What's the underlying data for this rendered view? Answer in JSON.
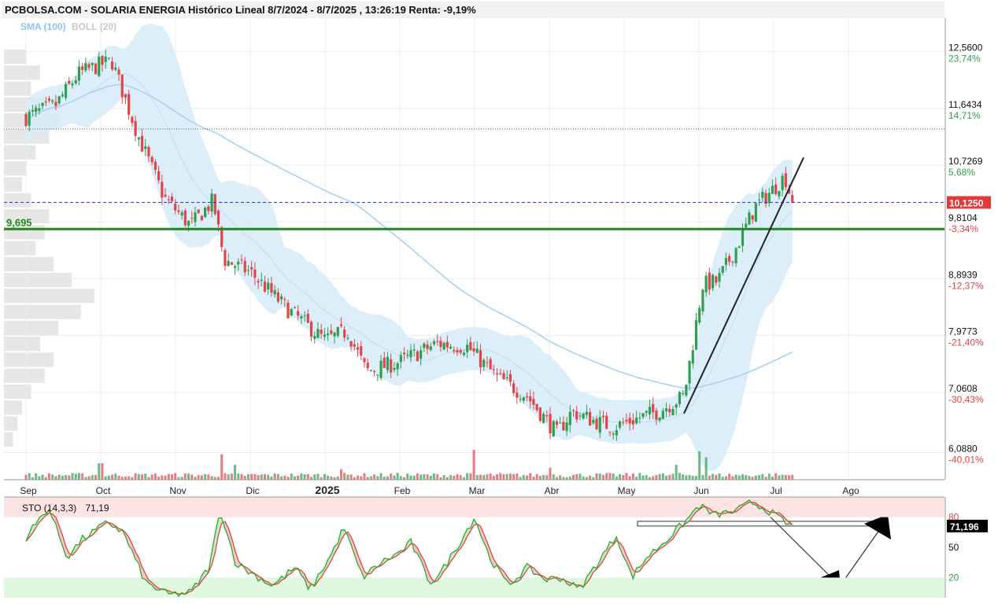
{
  "header": {
    "title": "PCBOLSA.COM - SOLARIA ENERGIA Histórico Lineal 8/7/2024 - 8/7/2025 , 13:26:19 Renta: -9,19%"
  },
  "legend": {
    "sma_label": "SMA (100)",
    "boll_label": "BOLL (20)"
  },
  "colors": {
    "up": "#2e9e4f",
    "down": "#e0454a",
    "boll_fill": "#d6ebf8",
    "sma": "#a8d2f0",
    "support": "#1e8a1e",
    "last_price_line": "#2233cc",
    "last_price_badge": "#e03a3a",
    "sto_k": "#2ea82e",
    "sto_d": "#e04444",
    "sto_overbought_band": "#fde4e4",
    "sto_oversold_band": "#e0f7e0",
    "volume_profile": "#dddddd"
  },
  "chart_data": [
    {
      "type": "candlestick",
      "title": "SOLARIA ENERGIA",
      "x_labels": [
        "Sep",
        "Oct",
        "Nov",
        "Dic",
        "2025",
        "Feb",
        "Mar",
        "Abr",
        "May",
        "Jun",
        "Jul",
        "Ago"
      ],
      "y_ticks": [
        {
          "value": 12.56,
          "label": "12,5600",
          "pct": "23,74%"
        },
        {
          "value": 11.6434,
          "label": "11,6434",
          "pct": "14,71%"
        },
        {
          "value": 10.7269,
          "label": "10,7269",
          "pct": "5,68%"
        },
        {
          "value": 9.8104,
          "label": "9,8104",
          "pct": "-3,34%"
        },
        {
          "value": 8.8939,
          "label": "8,8939",
          "pct": "-12,37%"
        },
        {
          "value": 7.9773,
          "label": "7,9773",
          "pct": "-21,40%"
        },
        {
          "value": 7.0608,
          "label": "7,0608",
          "pct": "-30,43%"
        },
        {
          "value": 6.088,
          "label": "6,0880",
          "pct": "-40,01%"
        }
      ],
      "ylim": [
        5.65,
        13.1
      ],
      "last_price": {
        "value": 10.125,
        "label": "10,1250"
      },
      "support_level": {
        "value": 9.695,
        "label": "9,695"
      },
      "reference_dotted_level": 11.31,
      "overlays": [
        "SMA (100)",
        "BOLL (20)"
      ],
      "price_anchors": [
        {
          "month": 0.0,
          "close": 11.5
        },
        {
          "month": 0.4,
          "close": 11.7
        },
        {
          "month": 0.7,
          "close": 12.2
        },
        {
          "month": 1.0,
          "close": 12.35
        },
        {
          "month": 1.15,
          "close": 12.4
        },
        {
          "month": 1.5,
          "close": 11.2
        },
        {
          "month": 1.85,
          "close": 10.2
        },
        {
          "month": 2.2,
          "close": 9.75
        },
        {
          "month": 2.5,
          "close": 10.15
        },
        {
          "month": 2.65,
          "close": 9.2
        },
        {
          "month": 3.0,
          "close": 9.0
        },
        {
          "month": 3.5,
          "close": 8.4
        },
        {
          "month": 4.0,
          "close": 7.9
        },
        {
          "month": 4.3,
          "close": 8.05
        },
        {
          "month": 4.55,
          "close": 7.4
        },
        {
          "month": 5.0,
          "close": 7.55
        },
        {
          "month": 5.5,
          "close": 7.85
        },
        {
          "month": 5.9,
          "close": 7.8
        },
        {
          "month": 6.3,
          "close": 7.3
        },
        {
          "month": 6.7,
          "close": 7.0
        },
        {
          "month": 7.1,
          "close": 6.4
        },
        {
          "month": 7.3,
          "close": 6.75
        },
        {
          "month": 7.6,
          "close": 6.6
        },
        {
          "month": 7.85,
          "close": 6.5
        },
        {
          "month": 8.2,
          "close": 6.65
        },
        {
          "month": 8.45,
          "close": 6.75
        },
        {
          "month": 8.8,
          "close": 7.0
        },
        {
          "month": 9.05,
          "close": 8.8
        },
        {
          "month": 9.25,
          "close": 8.85
        },
        {
          "month": 9.5,
          "close": 9.4
        },
        {
          "month": 9.75,
          "close": 10.05
        },
        {
          "month": 10.0,
          "close": 10.35
        },
        {
          "month": 10.15,
          "close": 10.55
        },
        {
          "month": 10.25,
          "close": 10.125
        }
      ],
      "volume_spikes": [
        {
          "month": 1.0,
          "ratio": 0.55
        },
        {
          "month": 2.6,
          "ratio": 0.85
        },
        {
          "month": 2.8,
          "ratio": 0.5
        },
        {
          "month": 4.2,
          "ratio": 0.35
        },
        {
          "month": 6.0,
          "ratio": 1.0
        },
        {
          "month": 7.0,
          "ratio": 0.4
        },
        {
          "month": 8.7,
          "ratio": 0.5
        },
        {
          "month": 9.0,
          "ratio": 0.95
        },
        {
          "month": 9.1,
          "ratio": 0.75
        }
      ],
      "volume_profile_widths": [
        0.25,
        0.4,
        0.3,
        0.55,
        0.6,
        0.5,
        0.35,
        0.25,
        0.2,
        0.3,
        0.5,
        0.45,
        0.35,
        0.55,
        0.75,
        1.0,
        0.85,
        0.6,
        0.4,
        0.55,
        0.45,
        0.3,
        0.2,
        0.15,
        0.1
      ]
    },
    {
      "type": "line",
      "title": "STO (14,3,3)",
      "value_label": "71,19",
      "current": {
        "value": 71.196,
        "label": "71,196"
      },
      "y_ticks": [
        {
          "value": 80,
          "label": "80"
        },
        {
          "value": 50,
          "label": "50"
        },
        {
          "value": 20,
          "label": "20"
        }
      ],
      "ylim": [
        0,
        100
      ],
      "series": [
        {
          "name": "%K",
          "anchors": [
            [
              0.0,
              60
            ],
            [
              0.3,
              90
            ],
            [
              0.55,
              40
            ],
            [
              0.75,
              58
            ],
            [
              1.1,
              75
            ],
            [
              1.3,
              65
            ],
            [
              1.6,
              15
            ],
            [
              1.9,
              3
            ],
            [
              2.2,
              5
            ],
            [
              2.45,
              30
            ],
            [
              2.6,
              88
            ],
            [
              2.8,
              35
            ],
            [
              3.0,
              25
            ],
            [
              3.3,
              12
            ],
            [
              3.6,
              30
            ],
            [
              3.8,
              8
            ],
            [
              4.1,
              45
            ],
            [
              4.25,
              70
            ],
            [
              4.5,
              20
            ],
            [
              4.75,
              35
            ],
            [
              5.0,
              45
            ],
            [
              5.15,
              55
            ],
            [
              5.4,
              15
            ],
            [
              5.55,
              25
            ],
            [
              5.8,
              55
            ],
            [
              6.0,
              80
            ],
            [
              6.2,
              40
            ],
            [
              6.45,
              12
            ],
            [
              6.7,
              30
            ],
            [
              6.95,
              18
            ],
            [
              7.15,
              20
            ],
            [
              7.4,
              8
            ],
            [
              7.6,
              30
            ],
            [
              7.9,
              62
            ],
            [
              8.1,
              20
            ],
            [
              8.3,
              40
            ],
            [
              8.6,
              60
            ],
            [
              8.85,
              78
            ],
            [
              9.0,
              92
            ],
            [
              9.2,
              82
            ],
            [
              9.5,
              86
            ],
            [
              9.7,
              95
            ],
            [
              9.9,
              88
            ],
            [
              10.2,
              72
            ]
          ]
        },
        {
          "name": "%D",
          "derived_from": "%K",
          "smoothing": 3
        }
      ]
    }
  ]
}
